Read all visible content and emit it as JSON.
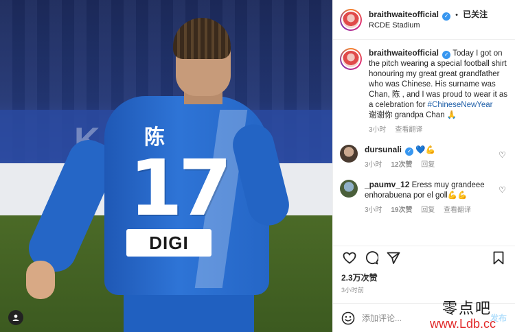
{
  "header": {
    "username": "braithwaiteofficial",
    "separator": "•",
    "follow_state": "已关注",
    "location": "RCDE Stadium"
  },
  "photo": {
    "jersey_character": "陈",
    "jersey_number": "17",
    "sponsor_text": "DIGI",
    "background_letters": "K"
  },
  "caption": {
    "username": "braithwaiteofficial",
    "text": "Today I got on the pitch wearing a special football shirt honouring my great great grandfather who was Chinese. His surname was Chan, 陈 , and I was proud to wear it as a celebration for",
    "hashtag": "#ChineseNewYear",
    "text2": "谢谢你 grandpa Chan 🙏",
    "time": "3小时",
    "translate": "查看翻译"
  },
  "comments": [
    {
      "username": "dursunali",
      "text": "💙💪",
      "time": "3小时",
      "likes": "12次赞",
      "reply": "回复",
      "translate": ""
    },
    {
      "username": "_paumv_12",
      "text": "Eress muy grandeee enhorabuena por el goll💪💪",
      "time": "3小时",
      "likes": "19次赞",
      "reply": "回复",
      "translate": "查看翻译"
    }
  ],
  "actions": {
    "icons": [
      "heart-icon",
      "comment-icon",
      "share-icon",
      "bookmark-icon"
    ]
  },
  "likes_count": "2.3万次赞",
  "posted_time": "3小时前",
  "composer": {
    "placeholder": "添加评论...",
    "post_label": "发布"
  },
  "watermark": {
    "cn": "零点吧",
    "url": "www.Ldb.cc"
  },
  "colors": {
    "verified": "#3897f0",
    "hashtag": "#1f5fa8",
    "post_button": "#b2dffc",
    "watermark_url": "#e12a2a",
    "jersey_blue": "#2566c6"
  }
}
